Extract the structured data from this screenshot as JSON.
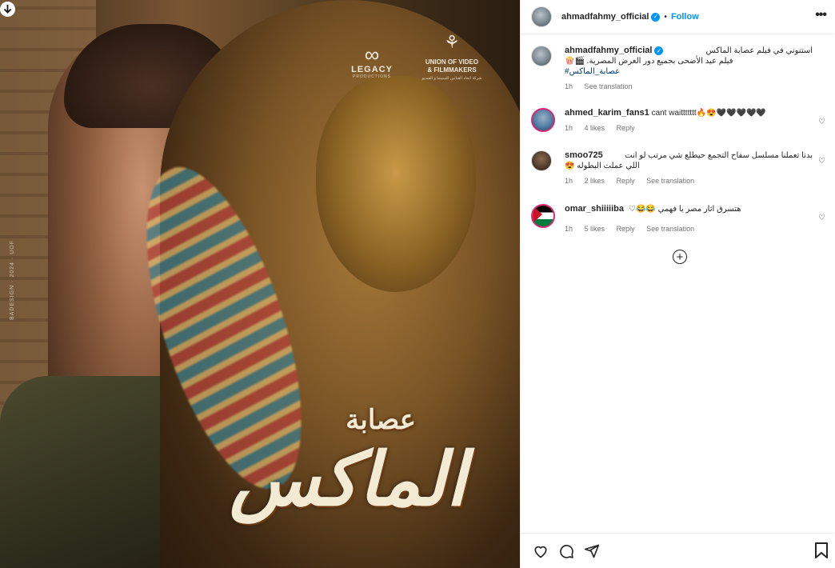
{
  "media": {
    "logo_legacy": "LEGACY",
    "logo_legacy_sub": "PRODUCTIONS",
    "logo_union_line1": "UNION OF VIDEO",
    "logo_union_line2": "& FILMMAKERS",
    "logo_union_sub": "شركة اتحاد الفنانين للسينما و الفيديو",
    "title_top": "عصابة",
    "title_main": "الماكس",
    "credit": "BADESIGN · 2024 · UOF",
    "download_icon": "download-arrow-icon"
  },
  "header": {
    "username": "ahmadfahmy_official",
    "verified_icon": "verified-badge-icon",
    "dot": "•",
    "follow_label": "Follow",
    "more_icon": "more-options-icon",
    "more_glyph": "•••"
  },
  "caption": {
    "username": "ahmadfahmy_official",
    "line1": "استنوني في فيلم عصابة الماكس",
    "line2": "فيلم عيد الأضحى بجميع دور العرض المصرية. 🎬🍿",
    "hashtag": "#عصابة_الماكس",
    "time": "1h",
    "see_translation": "See translation"
  },
  "comments": [
    {
      "username": "ahmed_karim_fans1",
      "text": "cant waittttttt🔥😍🖤🖤🖤🖤🖤",
      "time": "1h",
      "likes": "4 likes",
      "reply": "Reply",
      "see_translation": ""
    },
    {
      "username": "smoo725",
      "text": "بدنا تعملنا مسلسل سفاح التجمع حيطلع شي مرتب لو انت",
      "text2": "اللي عملت البطوله 😍",
      "time": "1h",
      "likes": "2 likes",
      "reply": "Reply",
      "see_translation": "See translation"
    },
    {
      "username": "omar_shiiiiiba",
      "text": "هتسرق اثار مصر يا فهمي 😂😂♡",
      "time": "1h",
      "likes": "5 likes",
      "reply": "Reply",
      "see_translation": "See translation"
    }
  ],
  "load_more_icon": "plus-circle-icon",
  "actions": {
    "like_icon": "heart-icon",
    "comment_icon": "comment-icon",
    "share_icon": "paper-plane-icon",
    "save_icon": "bookmark-icon"
  },
  "colors": {
    "accent": "#0095f6",
    "text": "#262626",
    "muted": "#737373",
    "hashtag": "#00376b",
    "border": "#efefef",
    "story_ring": "#d62976"
  }
}
